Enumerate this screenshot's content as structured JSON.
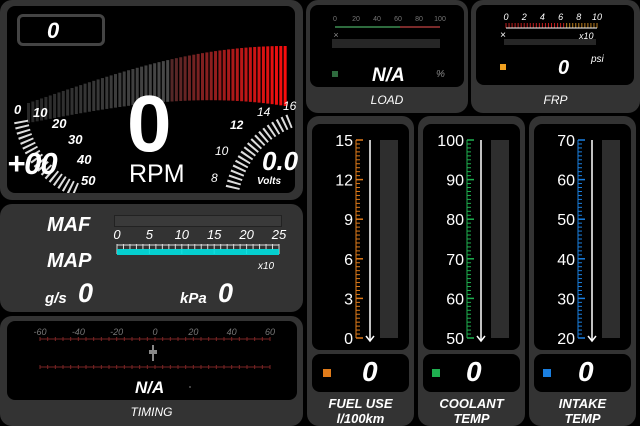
{
  "rpm": {
    "odometer": "0",
    "value": "0",
    "unit": "RPM",
    "ticks": [
      "0",
      "10",
      "20",
      "30",
      "40",
      "50"
    ],
    "boost_readout": "+00"
  },
  "volts": {
    "ticks": [
      "8",
      "10",
      "12",
      "14",
      "16"
    ],
    "value": "0.0",
    "unit": "Volts"
  },
  "load": {
    "ticks": [
      "0",
      "20",
      "40",
      "60",
      "80",
      "100"
    ],
    "value": "N/A",
    "unit": "%",
    "label": "LOAD",
    "status_color": "#2e6b3e"
  },
  "frp": {
    "ticks": [
      "0",
      "2",
      "4",
      "6",
      "8",
      "10"
    ],
    "multiplier": "x10",
    "value": "0",
    "unit": "psi",
    "label": "FRP",
    "marker_color": "#f0a020"
  },
  "maf_map": {
    "maf_label": "MAF",
    "map_label": "MAP",
    "ticks": [
      "0",
      "5",
      "10",
      "15",
      "20",
      "25"
    ],
    "multiplier": "x10",
    "maf_unit": "g/s",
    "maf_value": "0",
    "map_unit": "kPa",
    "map_value": "0",
    "map_bar_color": "#00e0e0"
  },
  "timing": {
    "ticks": [
      "-60",
      "-40",
      "-20",
      "0",
      "20",
      "40",
      "60"
    ],
    "value": "N/A",
    "label": "TIMING"
  },
  "fuel": {
    "ticks": [
      "15",
      "12",
      "9",
      "6",
      "3",
      "0"
    ],
    "value": "0",
    "label_line1": "FUEL USE",
    "label_line2": "l/100km",
    "color": "#e07b1a"
  },
  "coolant": {
    "ticks": [
      "100",
      "90",
      "80",
      "70",
      "60",
      "50"
    ],
    "value": "0",
    "label_line1": "COOLANT",
    "label_line2": "TEMP",
    "color": "#1fb050"
  },
  "intake": {
    "ticks": [
      "70",
      "60",
      "50",
      "40",
      "30",
      "20"
    ],
    "value": "0",
    "label_line1": "INTAKE",
    "label_line2": "TEMP",
    "color": "#1a7fe0"
  }
}
